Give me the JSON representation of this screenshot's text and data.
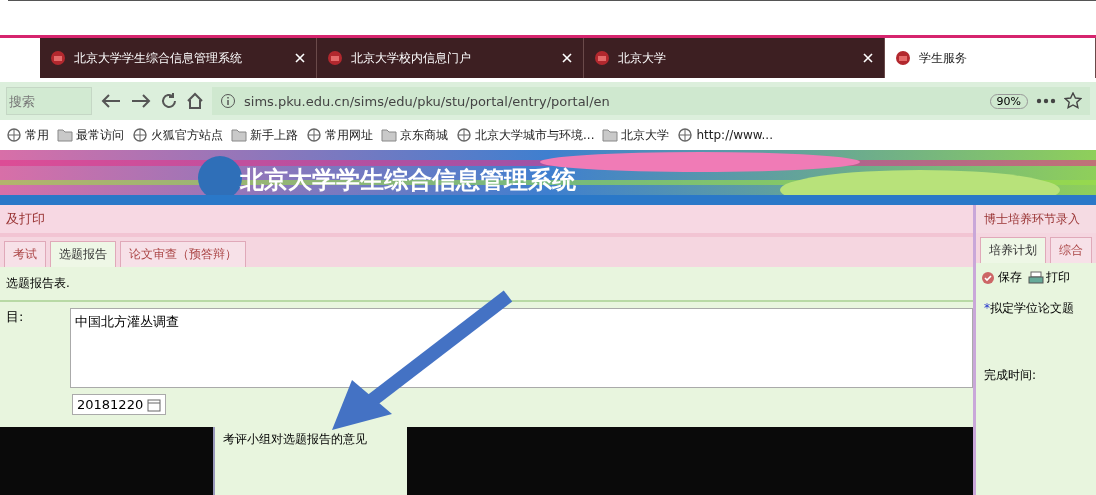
{
  "browser": {
    "tabs": [
      {
        "title": "北京大学学生综合信息管理系统",
        "selected": false
      },
      {
        "title": "北京大学校内信息门户",
        "selected": false
      },
      {
        "title": "北京大学",
        "selected": false
      },
      {
        "title": "学生服务",
        "selected": true
      }
    ],
    "search": {
      "placeholder": "搜索"
    },
    "url": "sims.pku.edu.cn/sims/edu/pku/stu/portal/entry/portal/en",
    "zoom": "90%",
    "bookmarks": [
      "常用",
      "最常访问",
      "火狐官方站点",
      "新手上路",
      "常用网址",
      "京东商城",
      "北京大学城市与环境...",
      "北京大学",
      "http://www..."
    ]
  },
  "system_title": "北京大学学生综合信息管理系统",
  "main_panel": {
    "title": "及打印",
    "tabs": [
      {
        "label": "考试",
        "selected": false
      },
      {
        "label": "选题报告",
        "selected": true
      },
      {
        "label": "论文审查（预答辩）",
        "selected": false
      }
    ],
    "caption": "选题报告表.",
    "topic_label": "目:",
    "topic_value": "中国北方灌丛调查",
    "date_value": "20181220",
    "note": "考评小组对选题报告的意见"
  },
  "side_panel": {
    "title": "博士培养环节录入",
    "tabs": [
      {
        "label": "培养计划",
        "selected": true
      },
      {
        "label": "综合",
        "selected": false
      }
    ],
    "buttons": [
      "保存",
      "打印"
    ],
    "fields": [
      {
        "mark": "*",
        "label": "拟定学位论文题"
      },
      {
        "label": "完成时间:"
      }
    ]
  }
}
